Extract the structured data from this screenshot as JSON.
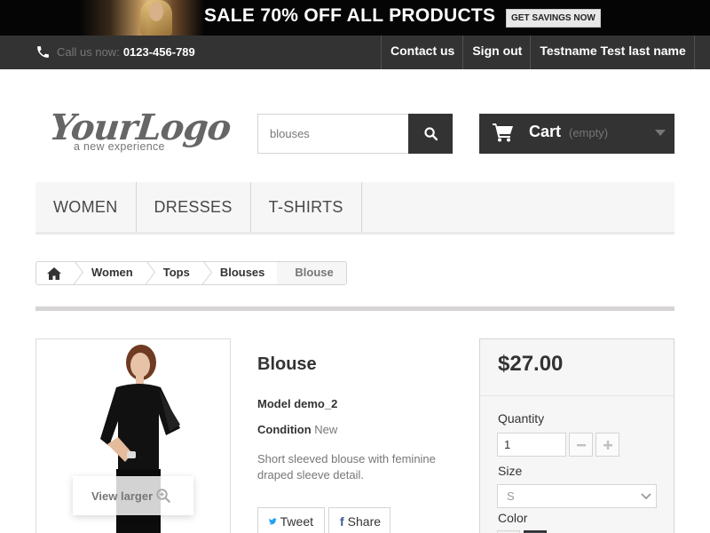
{
  "banner": {
    "headline": "SALE 70% OFF ALL PRODUCTS",
    "cta": "GET SAVINGS NOW"
  },
  "topbar": {
    "phone_label": "Call us now:",
    "phone_number": "0123-456-789",
    "links": [
      "Contact us",
      "Sign out",
      "Testname Test last name"
    ]
  },
  "header": {
    "logo_main": "YourLogo",
    "logo_tagline": "a new experience",
    "search_value": "blouses",
    "cart_label": "Cart",
    "cart_state": "(empty)"
  },
  "menu": [
    "WOMEN",
    "DRESSES",
    "T-SHIRTS"
  ],
  "breadcrumb": [
    "Women",
    "Tops",
    "Blouses",
    "Blouse"
  ],
  "product": {
    "title": "Blouse",
    "model_label": "Model",
    "model_value": "demo_2",
    "condition_label": "Condition",
    "condition_value": "New",
    "description": "Short sleeved blouse with feminine draped sleeve detail.",
    "view_larger": "View larger",
    "tweet": "Tweet",
    "share": "Share"
  },
  "buy_box": {
    "price": "$27.00",
    "quantity_label": "Quantity",
    "quantity_value": "1",
    "size_label": "Size",
    "size_value": "S",
    "color_label": "Color",
    "colors": [
      "#f1f1f1",
      "#434a54"
    ]
  }
}
